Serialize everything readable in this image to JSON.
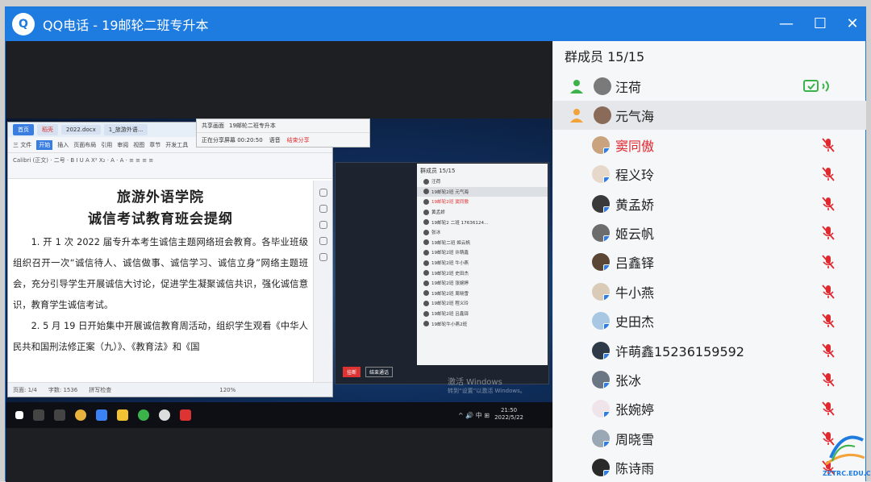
{
  "window": {
    "app_name": "QQ电话",
    "separator": " - ",
    "group_name": "19邮轮二班专升本",
    "minimize": "—",
    "maximize": "☐",
    "close": "✕"
  },
  "shared_screen": {
    "doc_tabs": [
      "首页",
      "稻壳",
      "2022.docx",
      "1_旅游外语..."
    ],
    "doc_menu": [
      "三 文件",
      "开始",
      "插入",
      "页面布局",
      "引用",
      "审阅",
      "视图",
      "章节",
      "开发工具"
    ],
    "doc_toolbar": "Calibri (正文)  ·  二号  ·  B I U A X² X₂  ·  A · A · ≡ ≡ ≡ ≡",
    "doc_title1": "旅游外语学院",
    "doc_title2": "诚信考试教育班会提纲",
    "doc_para1": "1. 开 1 次 2022 届专升本考生诚信主题网络班会教育。各毕业班级组织召开一次“诚信待人、诚信做事、诚信学习、诚信立身”网络主题班会，充分引导学生开展诚信大讨论，促进学生凝聚诚信共识，强化诚信意识，教育学生诚信考试。",
    "doc_para2": "2. 5 月 19 日开始集中开展诚信教育周活动，组织学生观看《中华人民共和国刑法修正案（九）》、《教育法》和《国",
    "doc_status": [
      "页面: 1/4",
      "字数: 1536",
      "拼写检查",
      "120%"
    ],
    "share_bar": {
      "tab_a": "共享画面",
      "tab_b": "19邮轮二班专升本",
      "status": "正在分享屏幕  00:20:50",
      "voice": "语音",
      "stop": "结束分享"
    },
    "inner_panel_title": "群成员 15/15",
    "inner_members": [
      "汪荷",
      "19邮轮2班 元气海",
      "19邮轮2班 窦同傲",
      "黄孟娇",
      "19邮轮2 二班 17636124...",
      "张冰",
      "19邮轮二班 姬云帆",
      "19邮轮2班 许萌鑫",
      "19邮轮2班 牛小燕",
      "19邮轮2班 史田杰",
      "19邮轮2班 张婉婷",
      "19邮轮2班 周晓雪",
      "19邮轮2班 程义玲",
      "19邮轮2班 吕鑫铎",
      "19邮轮牛小燕2班"
    ],
    "inner_buttons": [
      "挂断",
      "结束通话"
    ],
    "activate_title": "激活 Windows",
    "activate_sub": "转到“设置”以激活 Windows。",
    "taskbar_time": "21:50",
    "taskbar_date": "2022/5/22",
    "taskbar_tray": "^ 🔊 中 ⊞"
  },
  "panel": {
    "title": "群成员 15/15",
    "members": [
      {
        "name": "汪荷",
        "host": true,
        "speaking": true,
        "muted": false,
        "highlight": false
      },
      {
        "name": "元气海",
        "host": true,
        "speaking": false,
        "muted": false,
        "highlight": false
      },
      {
        "name": "窦同傲",
        "host": false,
        "speaking": false,
        "muted": true,
        "highlight": true
      },
      {
        "name": "程义玲",
        "host": false,
        "speaking": false,
        "muted": true,
        "highlight": false
      },
      {
        "name": "黄孟娇",
        "host": false,
        "speaking": false,
        "muted": true,
        "highlight": false
      },
      {
        "name": "姬云帆",
        "host": false,
        "speaking": false,
        "muted": true,
        "highlight": false
      },
      {
        "name": "吕鑫铎",
        "host": false,
        "speaking": false,
        "muted": true,
        "highlight": false
      },
      {
        "name": "牛小燕",
        "host": false,
        "speaking": false,
        "muted": true,
        "highlight": false
      },
      {
        "name": "史田杰",
        "host": false,
        "speaking": false,
        "muted": true,
        "highlight": false
      },
      {
        "name": "许萌鑫15236159592",
        "host": false,
        "speaking": false,
        "muted": true,
        "highlight": false
      },
      {
        "name": "张冰",
        "host": false,
        "speaking": false,
        "muted": true,
        "highlight": false
      },
      {
        "name": "张婉婷",
        "host": false,
        "speaking": false,
        "muted": true,
        "highlight": false
      },
      {
        "name": "周晓雪",
        "host": false,
        "speaking": false,
        "muted": true,
        "highlight": false
      },
      {
        "name": "陈诗雨",
        "host": false,
        "speaking": false,
        "muted": true,
        "highlight": false
      }
    ]
  },
  "watermark": "ZZTRC.EDU.CN",
  "colors": {
    "title_bar": "#1e7be0",
    "highlight_name": "#e0282e",
    "mic_off": "#e0282e",
    "speaking": "#3cb24a",
    "host_icon": "#f2a33a"
  }
}
